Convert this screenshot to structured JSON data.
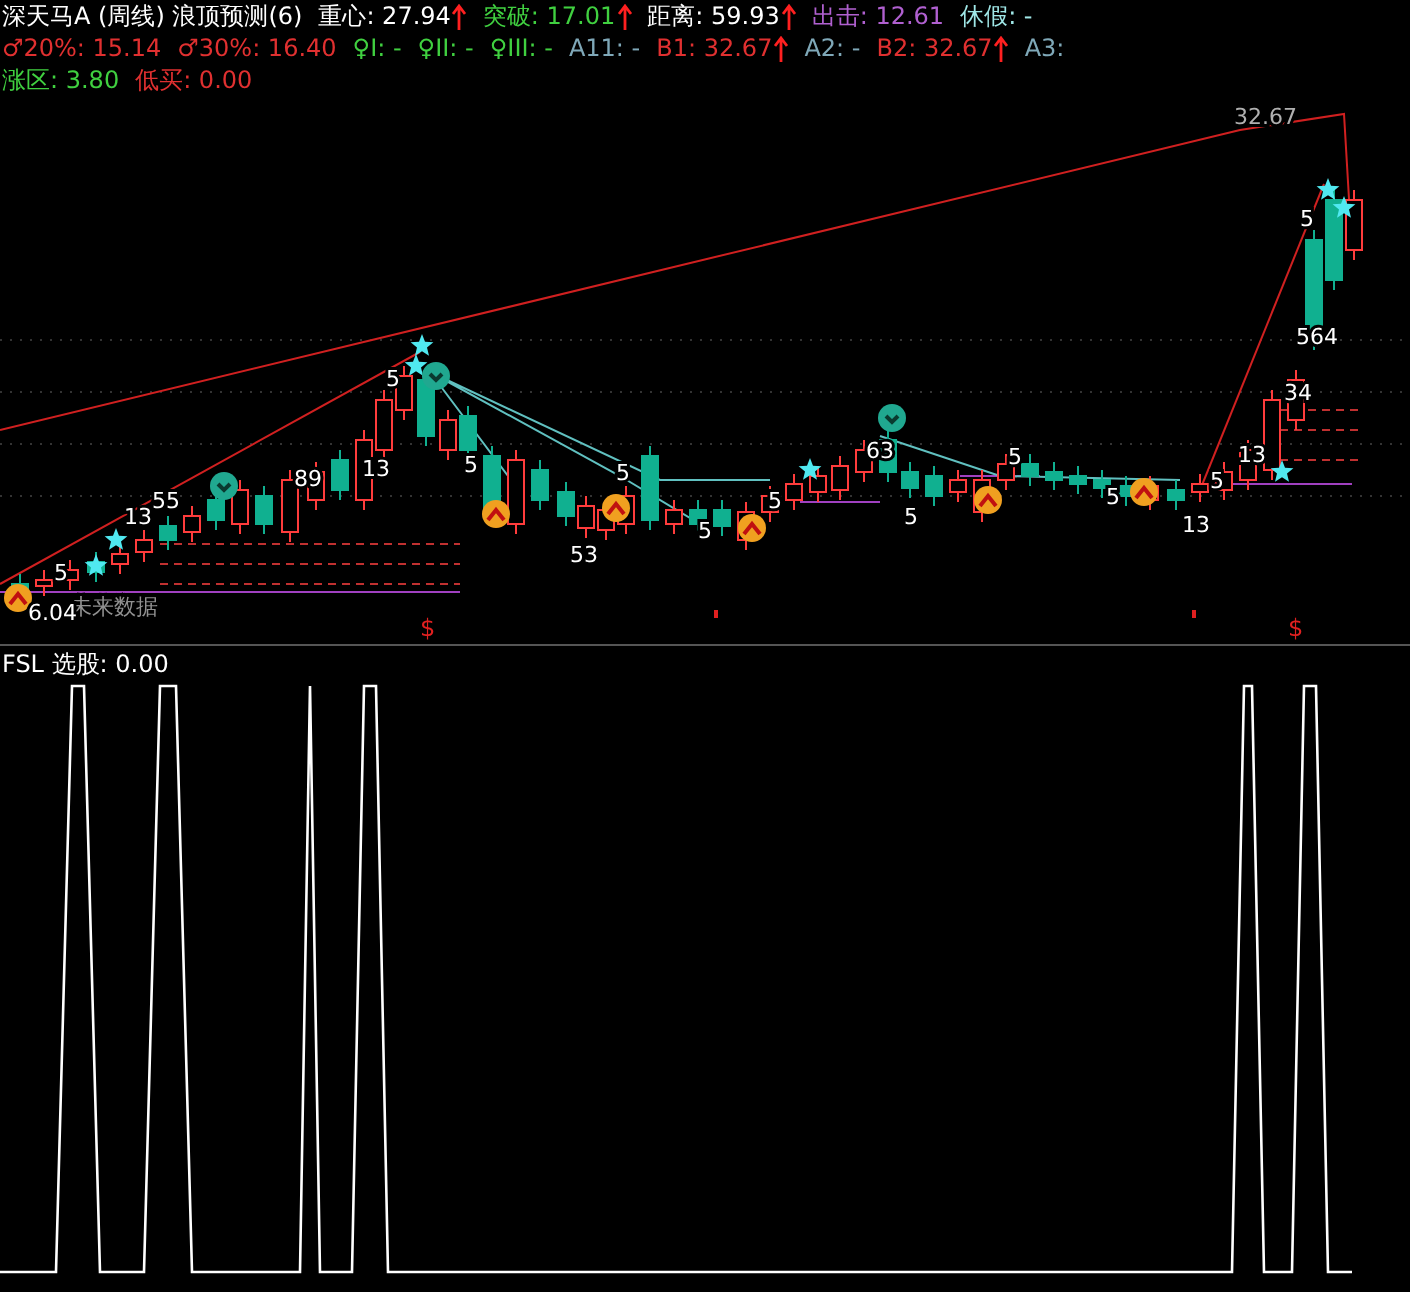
{
  "header": {
    "title": "深天马A (周线) 浪顶预测(6)",
    "lines": [
      [
        {
          "text": "重心: 27.94",
          "color": "#ffffff",
          "arrow": true
        },
        {
          "text": "突破: 17.01",
          "color": "#40d040",
          "arrow": true
        },
        {
          "text": "距离: 59.93",
          "color": "#ffffff",
          "arrow": true
        },
        {
          "text": "出击: 12.61",
          "color": "#b060d0",
          "arrow": false
        },
        {
          "text": "休假: -",
          "color": "#a0e8e8",
          "arrow": false
        }
      ],
      [
        {
          "text": "♂20%: 15.14",
          "color": "#e03030",
          "arrow": false
        },
        {
          "text": "♂30%: 16.40",
          "color": "#e03030",
          "arrow": false
        },
        {
          "text": "♀I: -",
          "color": "#40d040",
          "arrow": false
        },
        {
          "text": "♀II: -",
          "color": "#40d040",
          "arrow": false
        },
        {
          "text": "♀III: -",
          "color": "#40d040",
          "arrow": false
        },
        {
          "text": "A11: -",
          "color": "#7fa8b8",
          "arrow": false
        },
        {
          "text": "B1: 32.67",
          "color": "#e03030",
          "arrow": true
        },
        {
          "text": "A2: -",
          "color": "#7fa8b8",
          "arrow": false
        },
        {
          "text": "B2: 32.67",
          "color": "#e03030",
          "arrow": true
        },
        {
          "text": "A3:",
          "color": "#7fa8b8",
          "arrow": false
        }
      ],
      [
        {
          "text": "涨区: 3.80",
          "color": "#40d040",
          "arrow": false
        },
        {
          "text": "低买: 0.00",
          "color": "#e03030",
          "arrow": false
        }
      ]
    ]
  },
  "chart_labels": [
    {
      "text": "32.67",
      "kind": "price"
    },
    {
      "text": "5",
      "kind": "value"
    },
    {
      "text": "13",
      "kind": "value"
    },
    {
      "text": "55",
      "kind": "value"
    },
    {
      "text": "89",
      "kind": "value"
    },
    {
      "text": "13",
      "kind": "value"
    },
    {
      "text": "5",
      "kind": "value"
    },
    {
      "text": "5",
      "kind": "value"
    },
    {
      "text": "53",
      "kind": "value"
    },
    {
      "text": "5",
      "kind": "value"
    },
    {
      "text": "5",
      "kind": "value"
    },
    {
      "text": "5",
      "kind": "value"
    },
    {
      "text": "63",
      "kind": "value"
    },
    {
      "text": "5",
      "kind": "value"
    },
    {
      "text": "5",
      "kind": "value"
    },
    {
      "text": "5",
      "kind": "value"
    },
    {
      "text": "13",
      "kind": "value"
    },
    {
      "text": "5",
      "kind": "value"
    },
    {
      "text": "13",
      "kind": "value"
    },
    {
      "text": "5",
      "kind": "value"
    },
    {
      "text": "564",
      "kind": "value"
    },
    {
      "text": "34",
      "kind": "value"
    },
    {
      "text": "未来数据",
      "kind": "note"
    },
    {
      "text": "6.04",
      "kind": "value"
    },
    {
      "text": "$",
      "kind": "signal"
    },
    {
      "text": "$",
      "kind": "signal"
    }
  ],
  "sub_panel": {
    "title": "FSL 选股: 0.00"
  }
}
